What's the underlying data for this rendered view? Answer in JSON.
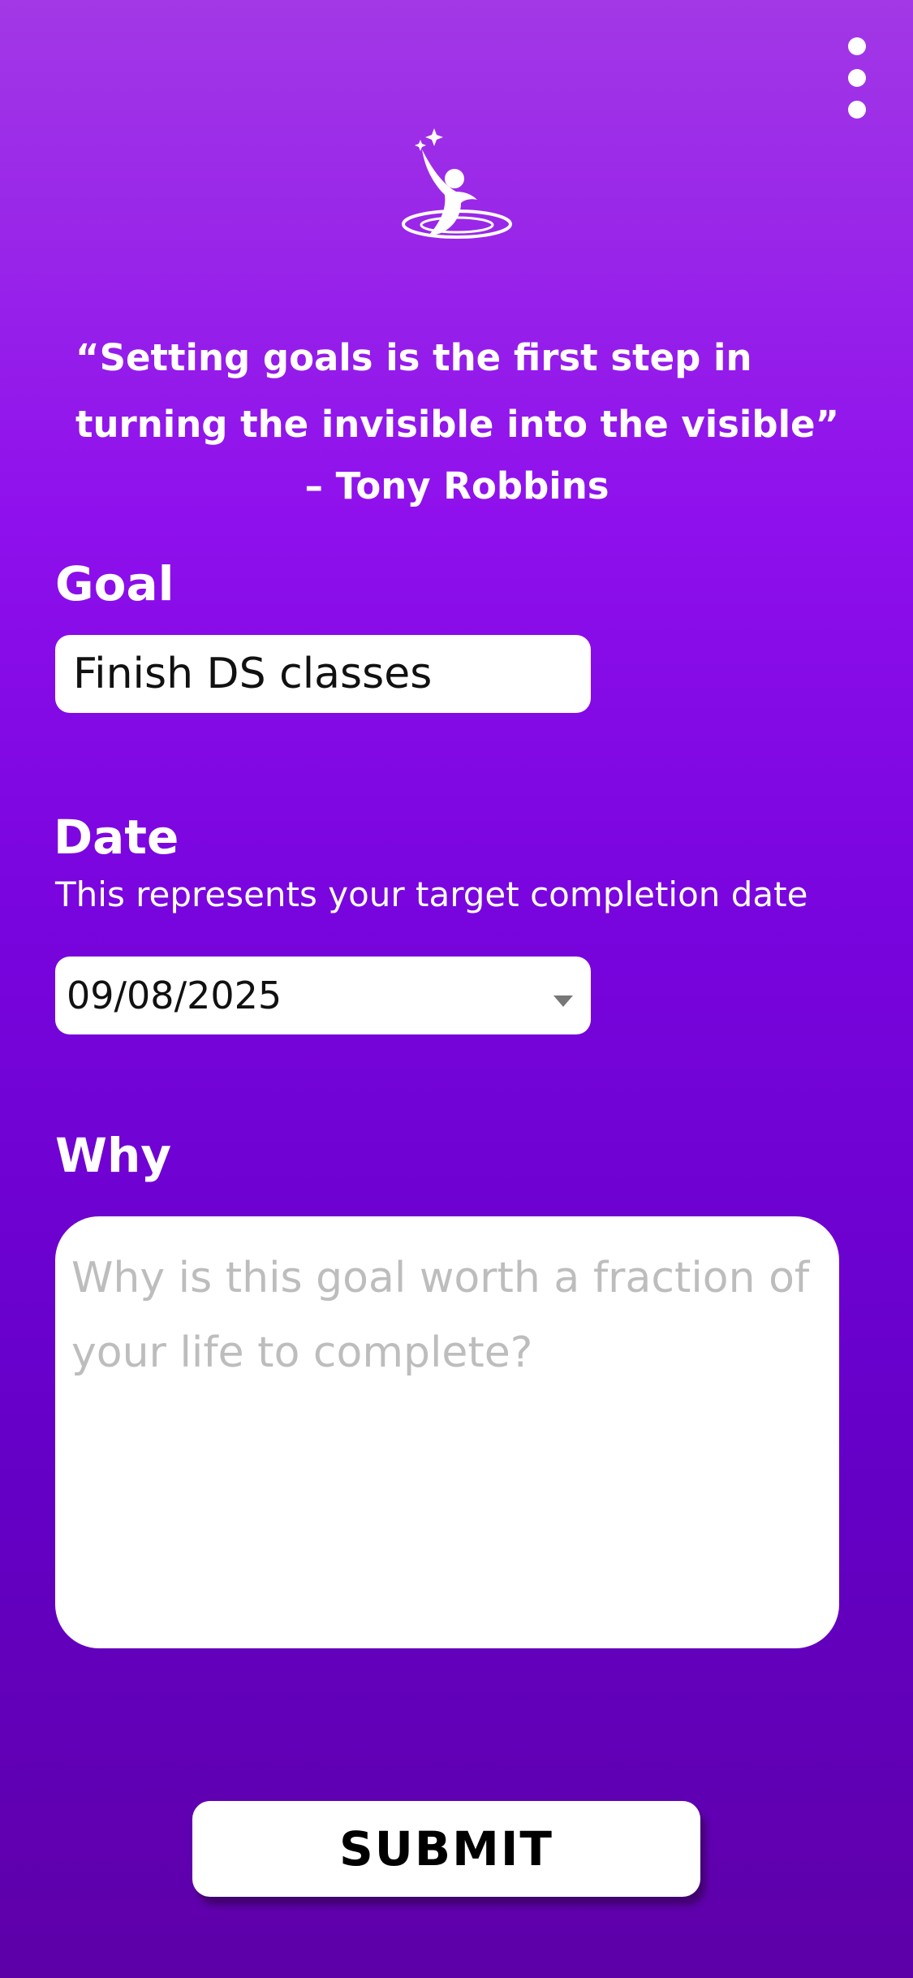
{
  "header": {
    "menu_icon": "more-vertical-icon",
    "logo_icon": "reaching-figure-stars-icon"
  },
  "quote": {
    "text": "“Setting goals is the first step in turning the invisible into the visible”",
    "author": "– Tony Robbins"
  },
  "goal": {
    "label": "Goal",
    "value": "Finish DS classes"
  },
  "date": {
    "label": "Date",
    "hint": "This represents your target completion date",
    "value": "09/08/2025"
  },
  "why": {
    "label": "Why",
    "placeholder": "Why is this goal worth a fraction of your life to complete?"
  },
  "submit": {
    "label": "SUBMIT"
  },
  "colors": {
    "background_top": "#a238e6",
    "background_bottom": "#5e00a8",
    "field_background": "#ffffff",
    "placeholder_text": "#bdbdbd"
  }
}
